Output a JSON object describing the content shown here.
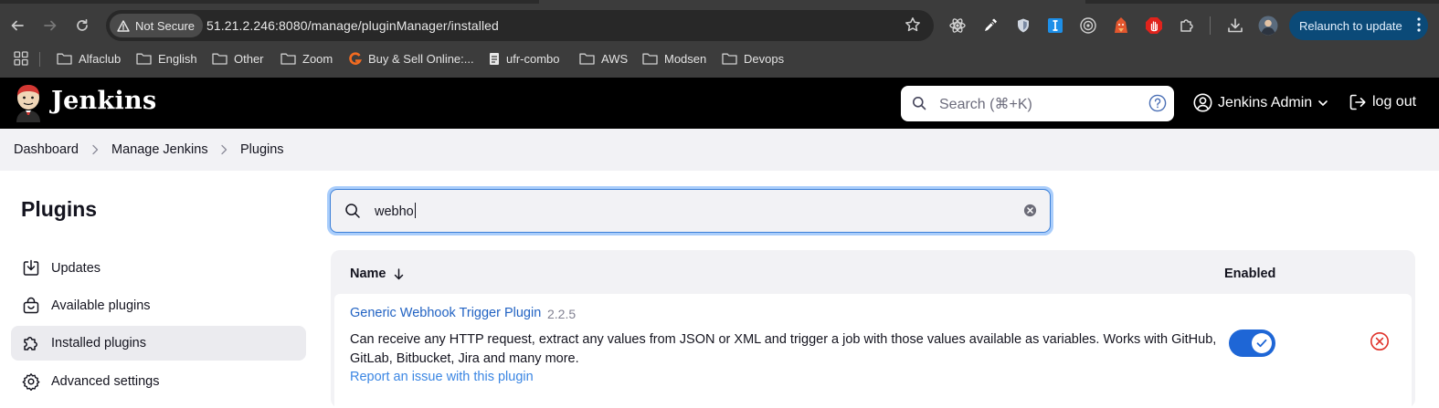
{
  "browser": {
    "security_label": "Not Secure",
    "url": "51.21.2.246:8080/manage/pluginManager/installed",
    "relaunch_label": "Relaunch to update",
    "bookmarks": [
      "Alfaclub",
      "English",
      "Other",
      "Zoom",
      "Buy & Sell Online:...",
      "ufr-combo",
      "AWS",
      "Modsen",
      "Devops"
    ],
    "extensions": [
      "react-devtools-icon",
      "eyedropper-icon",
      "shield-icon",
      "i-extension-icon",
      "target-icon",
      "fox-icon",
      "stop-hand-icon",
      "puzzle-icon"
    ]
  },
  "header": {
    "brand": "Jenkins",
    "search_placeholder": "Search (⌘+K)",
    "user_name": "Jenkins Admin",
    "logout_label": "log out"
  },
  "breadcrumb": [
    "Dashboard",
    "Manage Jenkins",
    "Plugins"
  ],
  "sidebar": {
    "title": "Plugins",
    "items": [
      {
        "label": "Updates",
        "icon": "download-icon",
        "active": false
      },
      {
        "label": "Available plugins",
        "icon": "shopping-bag-icon",
        "active": false
      },
      {
        "label": "Installed plugins",
        "icon": "puzzle-icon",
        "active": true
      },
      {
        "label": "Advanced settings",
        "icon": "gear-icon",
        "active": false
      }
    ]
  },
  "filter": {
    "value": "webho"
  },
  "table": {
    "col_name": "Name",
    "col_enabled": "Enabled",
    "rows": [
      {
        "name": "Generic Webhook Trigger Plugin",
        "version": "2.2.5",
        "description": "Can receive any HTTP request, extract any values from JSON or XML and trigger a job with those values available as variables. Works with GitHub, GitLab, Bitbucket, Jira and many more.",
        "report_link": "Report an issue with this plugin",
        "enabled": true
      }
    ]
  },
  "colors": {
    "link": "#2263c3",
    "toggle_on": "#1e66d6",
    "danger": "#e0332b",
    "header_bg": "#000000"
  }
}
